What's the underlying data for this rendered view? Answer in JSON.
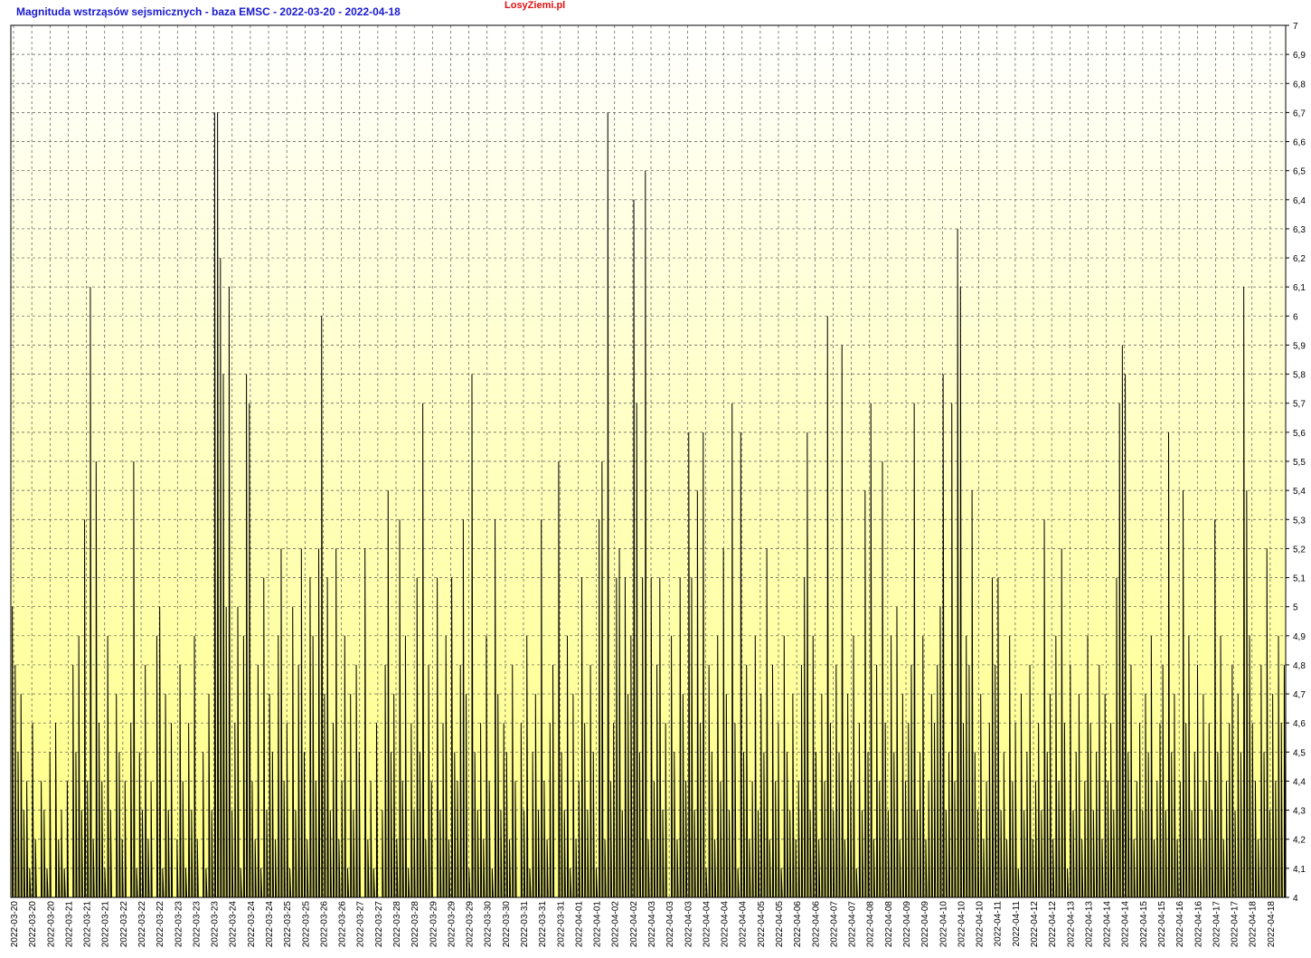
{
  "header": {
    "title": "Magnituda wstrząsów sejsmicznych - baza EMSC - 2022-03-20 - 2022-04-18",
    "site": "LosyZiemi.pl"
  },
  "colors": {
    "title": "#1a1ad0",
    "site": "#e01010",
    "line": "#000000",
    "grid": "#555555",
    "background_top": "#ffffff",
    "background_bottom": "#ffff80"
  },
  "chart_data": {
    "type": "line",
    "title": "Magnituda wstrząsów sejsmicznych - baza EMSC - 2022-03-20 - 2022-04-18",
    "xlabel": "",
    "ylabel": "",
    "ylim": [
      4,
      7
    ],
    "y_axis_side": "right",
    "grid": true,
    "y_ticks": [
      "4",
      "4,1",
      "4,2",
      "4,3",
      "4,4",
      "4,5",
      "4,6",
      "4,7",
      "4,8",
      "4,9",
      "5",
      "5,1",
      "5,2",
      "5,3",
      "5,4",
      "5,5",
      "5,6",
      "5,7",
      "5,8",
      "5,9",
      "6",
      "6,1",
      "6,2",
      "6,3",
      "6,4",
      "6,5",
      "6,6",
      "6,7",
      "6,8",
      "6,9",
      "7"
    ],
    "x_tick_labels": [
      "2022-03-20",
      "2022-03-20",
      "2022-03-20",
      "2022-03-21",
      "2022-03-21",
      "2022-03-21",
      "2022-03-22",
      "2022-03-22",
      "2022-03-22",
      "2022-03-23",
      "2022-03-23",
      "2022-03-23",
      "2022-03-24",
      "2022-03-24",
      "2022-03-24",
      "2022-03-25",
      "2022-03-25",
      "2022-03-26",
      "2022-03-26",
      "2022-03-27",
      "2022-03-27",
      "2022-03-28",
      "2022-03-28",
      "2022-03-29",
      "2022-03-29",
      "2022-03-29",
      "2022-03-30",
      "2022-03-30",
      "2022-03-31",
      "2022-03-31",
      "2022-03-31",
      "2022-04-01",
      "2022-04-01",
      "2022-04-02",
      "2022-04-02",
      "2022-04-03",
      "2022-04-03",
      "2022-04-03",
      "2022-04-04",
      "2022-04-04",
      "2022-04-04",
      "2022-04-05",
      "2022-04-05",
      "2022-04-06",
      "2022-04-06",
      "2022-04-07",
      "2022-04-07",
      "2022-04-08",
      "2022-04-08",
      "2022-04-09",
      "2022-04-09",
      "2022-04-10",
      "2022-04-10",
      "2022-04-10",
      "2022-04-11",
      "2022-04-11",
      "2022-04-12",
      "2022-04-12",
      "2022-04-13",
      "2022-04-13",
      "2022-04-14",
      "2022-04-14",
      "2022-04-15",
      "2022-04-15",
      "2022-04-16",
      "2022-04-16",
      "2022-04-17",
      "2022-04-17",
      "2022-04-18",
      "2022-04-18"
    ],
    "series": [
      {
        "values": [
          5.0,
          4.8,
          4.5,
          4.7,
          4.3,
          4.4,
          4.1,
          4.6,
          4.2,
          4.0,
          4.4,
          4.3,
          4.1,
          4.5,
          4.0,
          4.6,
          4.2,
          4.3,
          4.1,
          4.4,
          4.0,
          4.8,
          4.5,
          4.9,
          4.3,
          5.3,
          4.4,
          6.1,
          4.2,
          5.5,
          4.6,
          4.4,
          4.1,
          4.9,
          4.3,
          4.0,
          4.7,
          4.5,
          4.2,
          4.4,
          4.0,
          4.6,
          5.5,
          4.1,
          4.5,
          4.3,
          4.8,
          4.2,
          4.4,
          4.0,
          4.9,
          5.0,
          4.1,
          4.7,
          4.3,
          4.6,
          4.0,
          4.2,
          4.8,
          4.4,
          4.1,
          4.6,
          4.3,
          4.9,
          4.2,
          4.0,
          4.5,
          4.1,
          4.7,
          4.3,
          6.7,
          6.7,
          6.2,
          5.8,
          5.0,
          6.1,
          4.3,
          4.6,
          5.0,
          4.1,
          4.9,
          5.8,
          5.7,
          4.4,
          4.2,
          4.8,
          4.1,
          5.1,
          4.3,
          4.7,
          4.5,
          4.2,
          4.9,
          5.2,
          4.4,
          4.6,
          4.1,
          5.0,
          4.3,
          4.8,
          5.2,
          4.5,
          4.2,
          5.1,
          4.9,
          4.4,
          5.2,
          6.0,
          4.7,
          5.1,
          4.3,
          4.6,
          5.2,
          4.2,
          4.4,
          4.9,
          4.1,
          4.7,
          4.3,
          4.8,
          4.5,
          4.0,
          5.2,
          4.2,
          4.4,
          4.1,
          4.6,
          4.0,
          4.3,
          4.8,
          5.4,
          4.5,
          4.7,
          4.2,
          5.3,
          4.4,
          4.9,
          4.1,
          4.6,
          4.3,
          5.1,
          4.5,
          5.7,
          4.2,
          4.8,
          4.4,
          4.0,
          5.1,
          4.3,
          4.6,
          4.9,
          4.2,
          5.1,
          4.5,
          4.4,
          4.8,
          5.3,
          4.7,
          4.1,
          5.8,
          4.5,
          4.3,
          4.6,
          4.2,
          4.9,
          4.4,
          4.1,
          5.3,
          4.7,
          4.3,
          4.6,
          4.5,
          4.2,
          4.8,
          4.4,
          4.0,
          4.6,
          4.3,
          4.9,
          4.1,
          4.5,
          4.7,
          4.3,
          5.3,
          4.4,
          4.2,
          4.6,
          4.8,
          4.0,
          5.5,
          4.5,
          4.3,
          4.9,
          4.1,
          4.7,
          4.2,
          4.4,
          5.1,
          4.6,
          4.3,
          4.8,
          4.5,
          4.1,
          5.3,
          5.5,
          4.2,
          6.7,
          4.4,
          4.6,
          5.1,
          5.2,
          4.3,
          5.1,
          4.7,
          4.9,
          6.4,
          5.7,
          4.5,
          5.1,
          6.5,
          4.2,
          5.1,
          4.4,
          4.8,
          5.1,
          4.3,
          4.6,
          4.0,
          4.9,
          4.5,
          4.2,
          5.1,
          4.7,
          4.4,
          5.6,
          5.1,
          4.3,
          5.4,
          4.6,
          5.6,
          4.1,
          4.8,
          4.5,
          4.2,
          4.9,
          4.4,
          5.2,
          4.7,
          4.3,
          5.7,
          4.6,
          4.1,
          5.6,
          4.5,
          4.8,
          4.2,
          4.4,
          4.9,
          4.3,
          4.7,
          4.5,
          5.2,
          4.2,
          4.8,
          4.4,
          4.6,
          4.1,
          4.9,
          4.5,
          4.3,
          4.7,
          4.2,
          4.4,
          4.8,
          5.1,
          5.6,
          4.3,
          4.9,
          4.5,
          4.2,
          4.7,
          4.4,
          6.0,
          4.6,
          4.3,
          4.8,
          4.5,
          5.9,
          4.2,
          4.7,
          4.4,
          4.9,
          4.1,
          4.6,
          4.3,
          5.4,
          4.5,
          5.7,
          4.2,
          4.8,
          4.4,
          5.5,
          4.6,
          4.3,
          4.9,
          4.5,
          5.0,
          4.2,
          4.7,
          4.4,
          4.6,
          4.8,
          5.7,
          4.3,
          4.5,
          4.9,
          4.2,
          4.4,
          4.7,
          4.6,
          4.8,
          5.0,
          5.8,
          4.3,
          4.5,
          5.7,
          4.4,
          6.3,
          6.1,
          4.6,
          4.9,
          4.8,
          5.4,
          4.5,
          4.3,
          4.7,
          4.2,
          4.4,
          4.6,
          5.1,
          4.8,
          5.1,
          4.3,
          4.5,
          4.2,
          4.9,
          4.4,
          4.6,
          4.1,
          4.7,
          4.3,
          4.5,
          4.8,
          4.2,
          4.4,
          4.6,
          4.3,
          5.3,
          4.5,
          4.7,
          4.2,
          4.9,
          4.4,
          5.2,
          4.6,
          4.1,
          4.8,
          4.3,
          4.5,
          4.7,
          4.2,
          4.4,
          4.9,
          4.6,
          4.3,
          4.5,
          4.8,
          4.2,
          4.7,
          4.4,
          4.6,
          4.3,
          5.1,
          5.7,
          5.9,
          5.8,
          4.5,
          4.8,
          4.2,
          4.4,
          4.6,
          4.3,
          4.7,
          4.5,
          4.9,
          4.2,
          4.4,
          4.6,
          4.8,
          4.3,
          5.6,
          4.5,
          4.7,
          4.2,
          4.4,
          5.4,
          4.6,
          4.9,
          4.3,
          4.5,
          4.8,
          4.2,
          4.7,
          4.4,
          4.6,
          4.3,
          5.3,
          4.5,
          4.9,
          4.2,
          4.4,
          4.6,
          4.8,
          4.3,
          4.7,
          4.5,
          6.1,
          5.4,
          4.9,
          4.6,
          4.4,
          4.2,
          4.8,
          4.5,
          5.2,
          4.3,
          4.7,
          4.4,
          4.9,
          4.6,
          4.8
        ]
      }
    ]
  }
}
